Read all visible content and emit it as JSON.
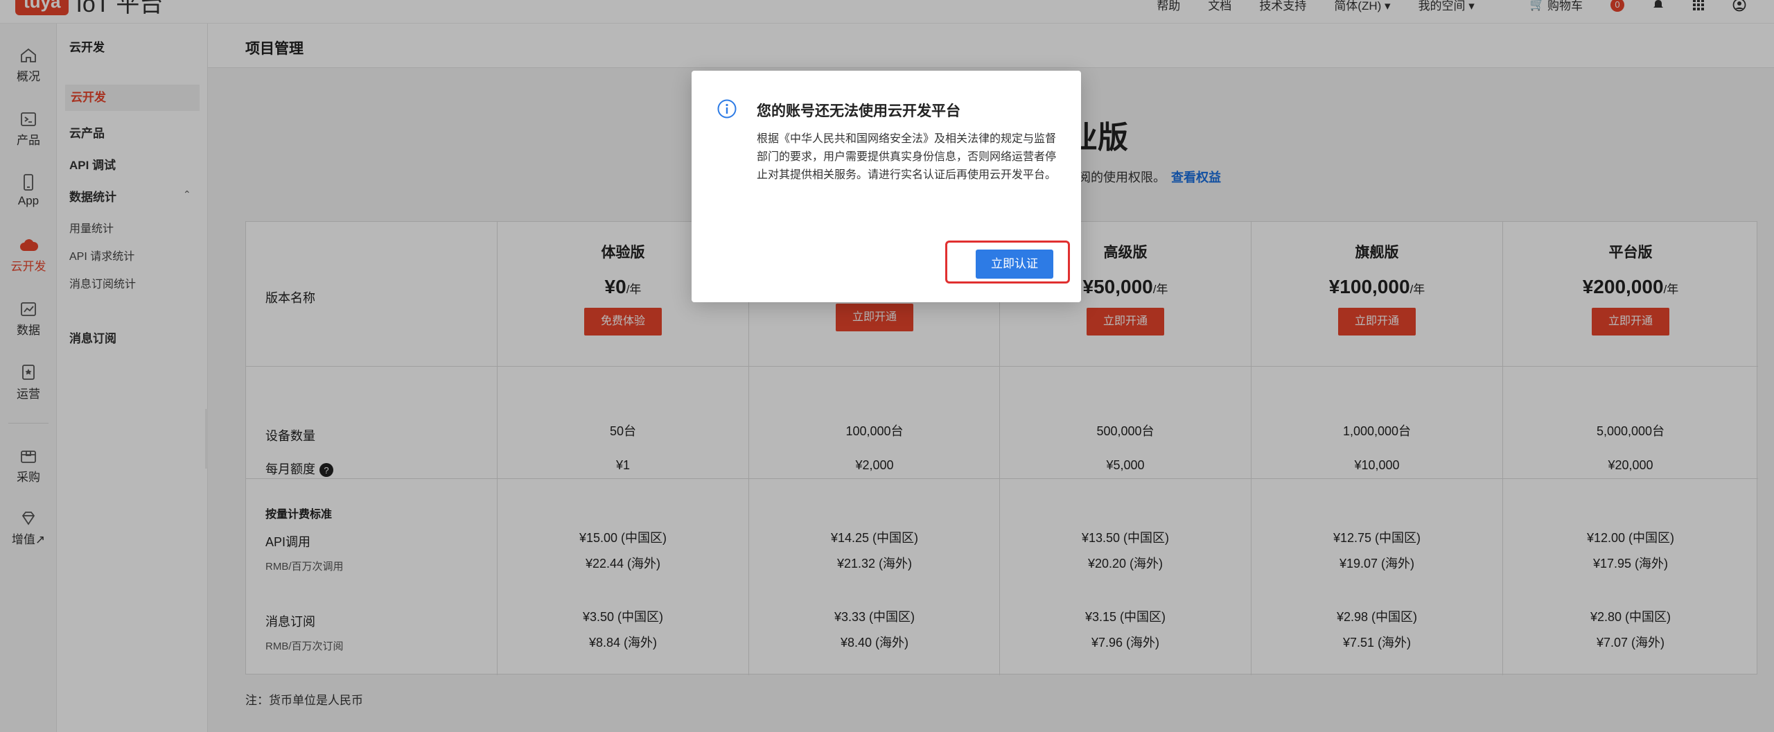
{
  "topbar": {
    "logo_badge": "tuya",
    "logo_text": "IoT 平台",
    "nav": [
      "帮助",
      "文档",
      "技术支持",
      "简体(ZH) ▾",
      "我的空间 ▾"
    ],
    "cart_label": "购物车",
    "cart_count": "0"
  },
  "rail": [
    {
      "label": "概况",
      "icon": "home-icon"
    },
    {
      "label": "产品",
      "icon": "terminal-icon"
    },
    {
      "label": "App",
      "icon": "phone-icon"
    },
    {
      "label": "云开发",
      "icon": "cloud-icon",
      "active": true
    },
    {
      "label": "数据",
      "icon": "chart-icon"
    },
    {
      "label": "运营",
      "icon": "badge-icon"
    },
    {
      "label": "采购",
      "icon": "box-icon"
    },
    {
      "label": "增值↗",
      "icon": "diamond-icon"
    }
  ],
  "sidebar": {
    "title": "云开发",
    "items": [
      "云开发",
      "云产品",
      "API 调试",
      "数据统计"
    ],
    "sub_items": [
      "用量统计",
      "API 请求统计",
      "消息订阅统计"
    ],
    "bottom_item": "消息订阅"
  },
  "main": {
    "title": "项目管理",
    "hero_title": "业版",
    "hero_desc": "订阅的使用权限。",
    "hero_link": "查看权益"
  },
  "pricing": {
    "col_label_name": "版本名称",
    "plans": [
      {
        "name": "体验版",
        "price": "¥0",
        "unit": "/年",
        "button": "免费体验"
      },
      {
        "name": "",
        "price": "",
        "unit": "",
        "button": "立即开通"
      },
      {
        "name": "高级版",
        "price": "¥50,000",
        "unit": "/年",
        "button": "立即开通"
      },
      {
        "name": "旗舰版",
        "price": "¥100,000",
        "unit": "/年",
        "button": "立即开通"
      },
      {
        "name": "平台版",
        "price": "¥200,000",
        "unit": "/年",
        "button": "立即开通"
      }
    ],
    "row_devices_label": "设备数量",
    "row_monthly_label": "每月额度",
    "devices": [
      "50台",
      "100,000台",
      "500,000台",
      "1,000,000台",
      "5,000,000台"
    ],
    "monthly": [
      "¥1",
      "¥2,000",
      "¥5,000",
      "¥10,000",
      "¥20,000"
    ],
    "usage_header": "按量计费标准",
    "api_label": "API调用",
    "api_sub": "RMB/百万次调用",
    "api_cn": [
      "¥15.00 (中国区)",
      "¥14.25 (中国区)",
      "¥13.50 (中国区)",
      "¥12.75 (中国区)",
      "¥12.00 (中国区)"
    ],
    "api_os": [
      "¥22.44 (海外)",
      "¥21.32 (海外)",
      "¥20.20 (海外)",
      "¥19.07 (海外)",
      "¥17.95 (海外)"
    ],
    "msg_label": "消息订阅",
    "msg_sub": "RMB/百万次订阅",
    "msg_cn": [
      "¥3.50 (中国区)",
      "¥3.33 (中国区)",
      "¥3.15 (中国区)",
      "¥2.98 (中国区)",
      "¥2.80 (中国区)"
    ],
    "msg_os": [
      "¥8.84 (海外)",
      "¥8.40 (海外)",
      "¥7.96 (海外)",
      "¥7.51 (海外)",
      "¥7.07 (海外)"
    ],
    "note": "注：货币单位是人民币"
  },
  "modal": {
    "title": "您的账号还无法使用云开发平台",
    "body": "根据《中华人民共和国网络安全法》及相关法律的规定与监督部门的要求，用户需要提供真实身份信息，否则网络运营者停止对其提供相关服务。请进行实名认证后再使用云开发平台。",
    "button": "立即认证"
  },
  "colors": {
    "accent": "#e8452c",
    "primary_button": "#2d7be5",
    "highlight_border": "#e03030"
  }
}
